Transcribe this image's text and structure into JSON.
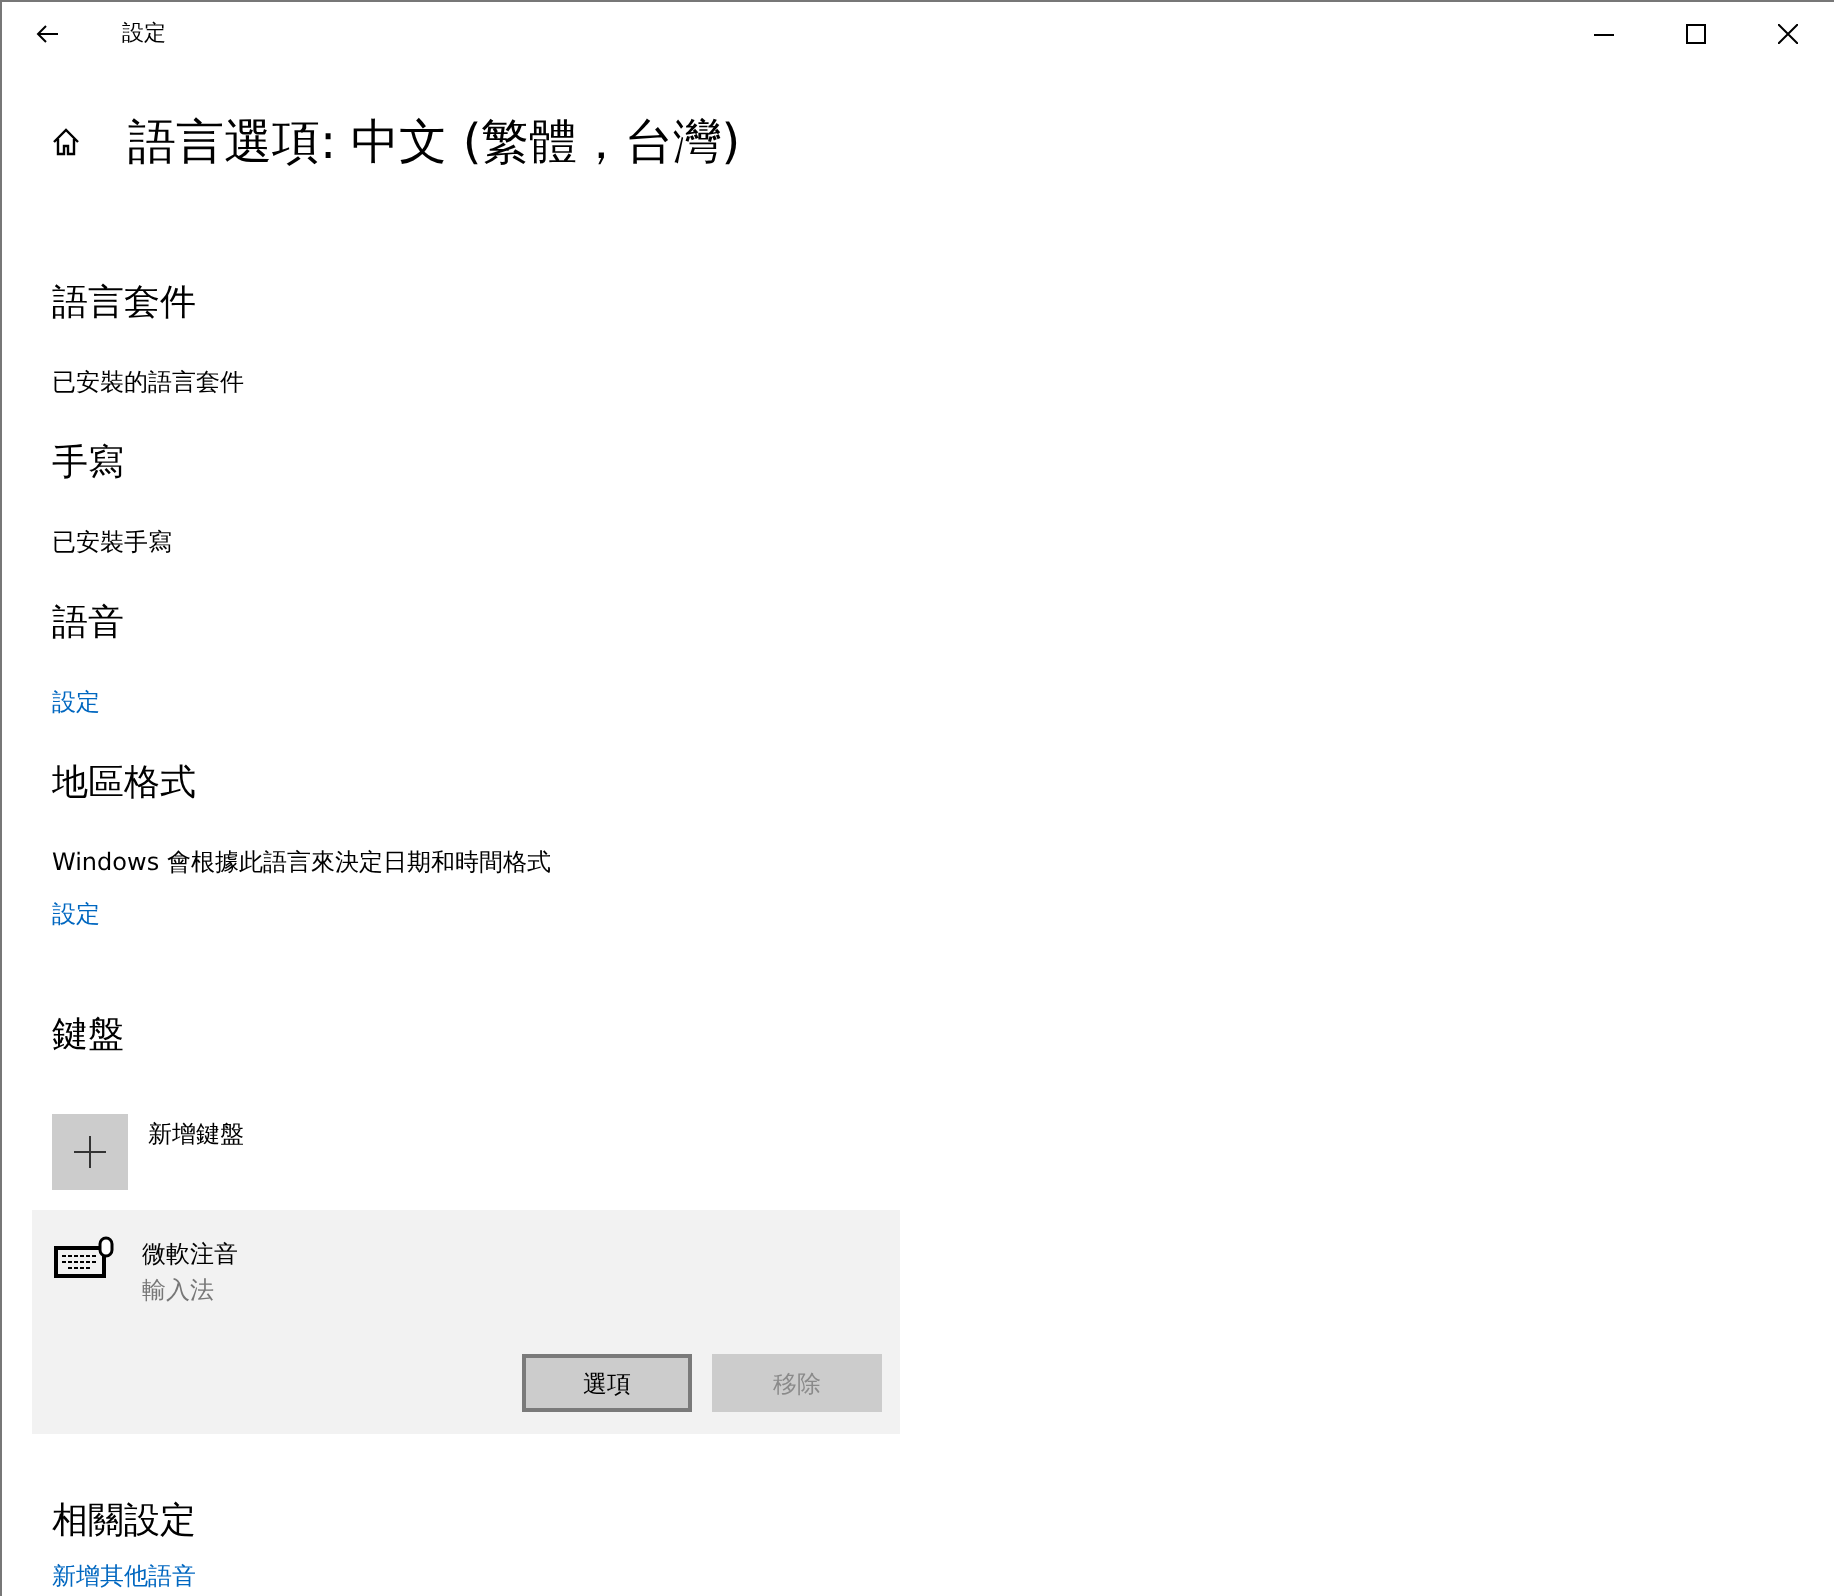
{
  "window": {
    "title": "設定"
  },
  "page_title": "語言選項: 中文 (繁體，台灣)",
  "sections": [
    {
      "kind": "heading",
      "text": "語言套件"
    },
    {
      "kind": "text",
      "text": "已安裝的語言套件"
    },
    {
      "kind": "heading",
      "text": "手寫"
    },
    {
      "kind": "text",
      "text": "已安裝手寫"
    },
    {
      "kind": "heading",
      "text": "語音"
    },
    {
      "kind": "link",
      "text": "設定"
    },
    {
      "kind": "heading",
      "text": "地區格式"
    },
    {
      "kind": "text",
      "text": "Windows 會根據此語言來決定日期和時間格式"
    },
    {
      "kind": "link",
      "text": "設定"
    }
  ],
  "keyboard": {
    "heading": "鍵盤",
    "add_label": "新增鍵盤",
    "items": [
      {
        "name": "微軟注音",
        "subtitle": "輸入法",
        "selected": true,
        "buttons": [
          {
            "label": "選項",
            "disabled": false
          },
          {
            "label": "移除",
            "disabled": true
          }
        ]
      }
    ]
  },
  "related": {
    "heading": "相關設定",
    "links": [
      "新增其他語音"
    ]
  }
}
